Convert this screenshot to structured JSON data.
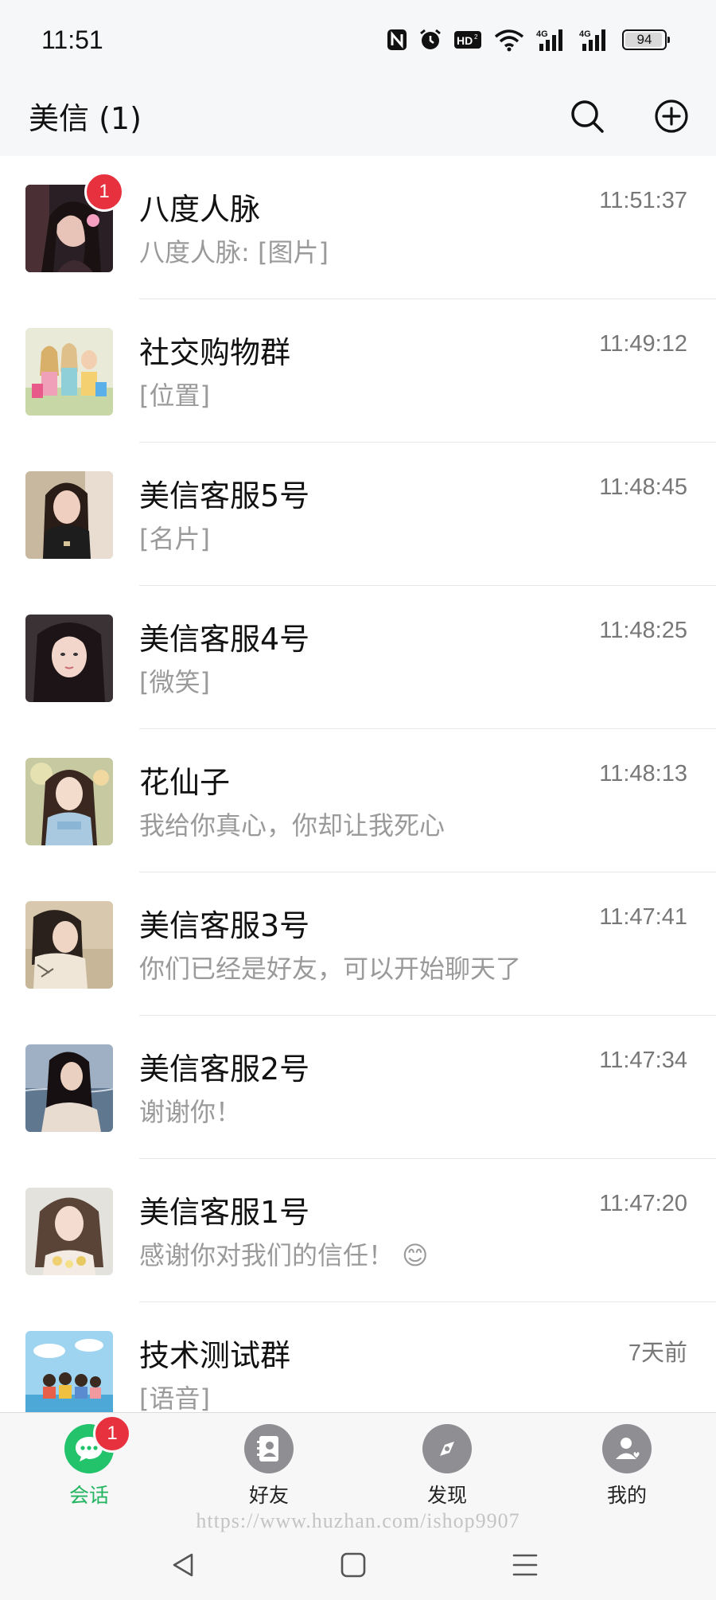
{
  "status_bar": {
    "time": "11:51",
    "battery": "94",
    "icons": [
      "nfc-icon",
      "alarm-icon",
      "hd-icon",
      "wifi-icon",
      "signal-4g-icon",
      "signal-4g-icon"
    ]
  },
  "header": {
    "title": "美信 (1)",
    "search_icon": "search-icon",
    "add_icon": "add-icon"
  },
  "chats": [
    {
      "name": "八度人脉",
      "time": "11:51:37",
      "preview": "八度人脉: [图片]",
      "unread": "1"
    },
    {
      "name": "社交购物群",
      "time": "11:49:12",
      "preview": "[位置]"
    },
    {
      "name": "美信客服5号",
      "time": "11:48:45",
      "preview": "[名片]"
    },
    {
      "name": "美信客服4号",
      "time": "11:48:25",
      "preview": "[微笑]"
    },
    {
      "name": "花仙子",
      "time": "11:48:13",
      "preview": "我给你真心，你却让我死心"
    },
    {
      "name": "美信客服3号",
      "time": "11:47:41",
      "preview": "你们已经是好友，可以开始聊天了"
    },
    {
      "name": "美信客服2号",
      "time": "11:47:34",
      "preview": "谢谢你！"
    },
    {
      "name": "美信客服1号",
      "time": "11:47:20",
      "preview": "感谢你对我们的信任！ 😊"
    },
    {
      "name": "技术测试群",
      "time": "7天前",
      "preview": "[语音]"
    }
  ],
  "bottom_nav": {
    "items": [
      {
        "label": "会话",
        "icon": "chat-bubble-icon",
        "active": true,
        "badge": "1"
      },
      {
        "label": "好友",
        "icon": "contacts-icon"
      },
      {
        "label": "发现",
        "icon": "compass-icon"
      },
      {
        "label": "我的",
        "icon": "profile-icon"
      }
    ]
  },
  "watermark": "https://www.huzhan.com/ishop9907",
  "colors": {
    "accent": "#22c36b",
    "badge": "#e8313e",
    "background": "#f6f7f9"
  }
}
